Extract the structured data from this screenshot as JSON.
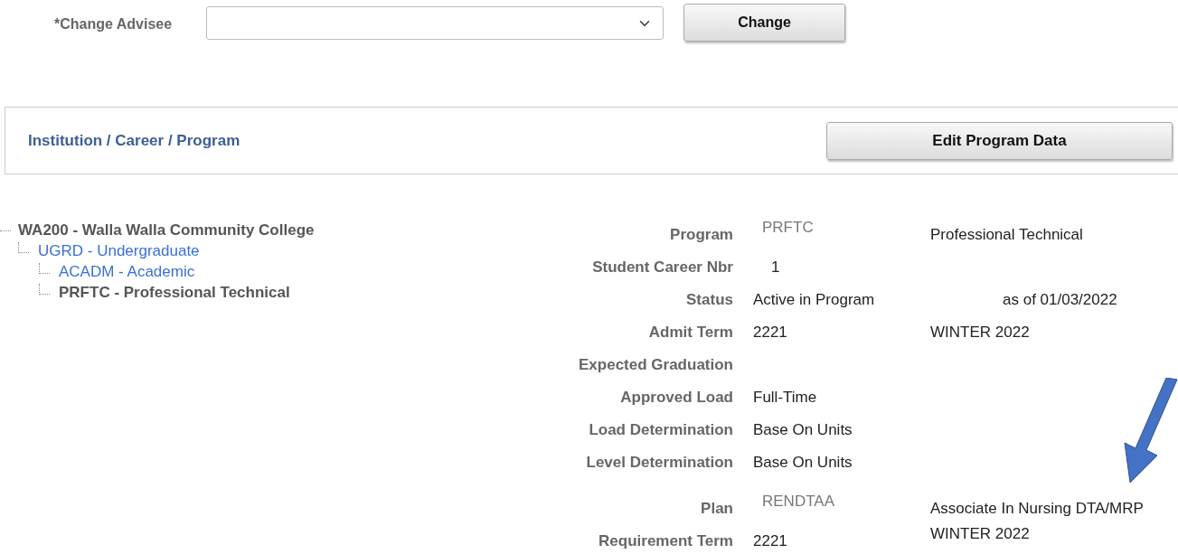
{
  "advisee": {
    "label": "*Change Advisee",
    "button": "Change"
  },
  "panel": {
    "title": "Institution / Career / Program",
    "button": "Edit Program Data"
  },
  "tree": [
    {
      "label": "WA200 - Walla Walla Community College",
      "selected": true,
      "children": [
        {
          "label": "UGRD - Undergraduate",
          "selected": false,
          "children": [
            {
              "label": "ACADM - Academic",
              "selected": false
            },
            {
              "label": "PRFTC - Professional Technical",
              "selected": true
            }
          ]
        }
      ]
    }
  ],
  "fields": [
    {
      "label": "Program",
      "kind": "code",
      "value": "PRFTC",
      "extra": "Professional Technical"
    },
    {
      "label": "Student Career Nbr",
      "kind": "indented",
      "value": "1"
    },
    {
      "label": "Status",
      "kind": "text",
      "value": "Active in Program",
      "extra": "as of 01/03/2022"
    },
    {
      "label": "Admit Term",
      "kind": "text",
      "value": "2221",
      "extra": "WINTER 2022"
    },
    {
      "label": "Expected Graduation",
      "kind": "text"
    },
    {
      "label": "Approved Load",
      "kind": "text",
      "value": "Full-Time"
    },
    {
      "label": "Load Determination",
      "kind": "text",
      "value": "Base On Units"
    },
    {
      "label": "Level Determination",
      "kind": "text",
      "value": "Base On Units"
    },
    {
      "label": "Plan",
      "kind": "code",
      "value": "RENDTAA",
      "extra": "Associate In Nursing DTA/MRP"
    },
    {
      "label": "Requirement Term",
      "kind": "text",
      "value": "2221",
      "extra": "WINTER 2022"
    }
  ]
}
